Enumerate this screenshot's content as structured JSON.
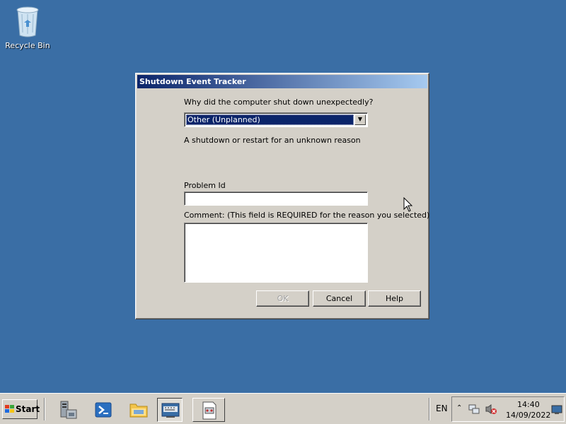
{
  "desktop": {
    "recycle_bin_label": "Recycle Bin"
  },
  "dialog": {
    "title": "Shutdown Event Tracker",
    "question": "Why did the computer shut down unexpectedly?",
    "reason_selected": "Other (Unplanned)",
    "reason_description": "A shutdown or restart for an unknown reason",
    "problem_id_label": "Problem Id",
    "problem_id_value": "",
    "comment_label": "Comment: (This field is REQUIRED for the reason you selected)",
    "comment_value": "",
    "buttons": {
      "ok": "OK",
      "cancel": "Cancel",
      "help": "Help"
    }
  },
  "taskbar": {
    "start_label": "Start",
    "icons": [
      "server-manager-icon",
      "powershell-icon",
      "explorer-icon",
      "keyboard-window-icon",
      "event-tracker-icon"
    ],
    "language": "EN",
    "time": "14:40",
    "date": "14/09/2022"
  },
  "colors": {
    "desktop": "#3a6ea5",
    "titlebar_start": "#0a246a",
    "titlebar_end": "#a6caf0",
    "face": "#d4d0c8"
  }
}
